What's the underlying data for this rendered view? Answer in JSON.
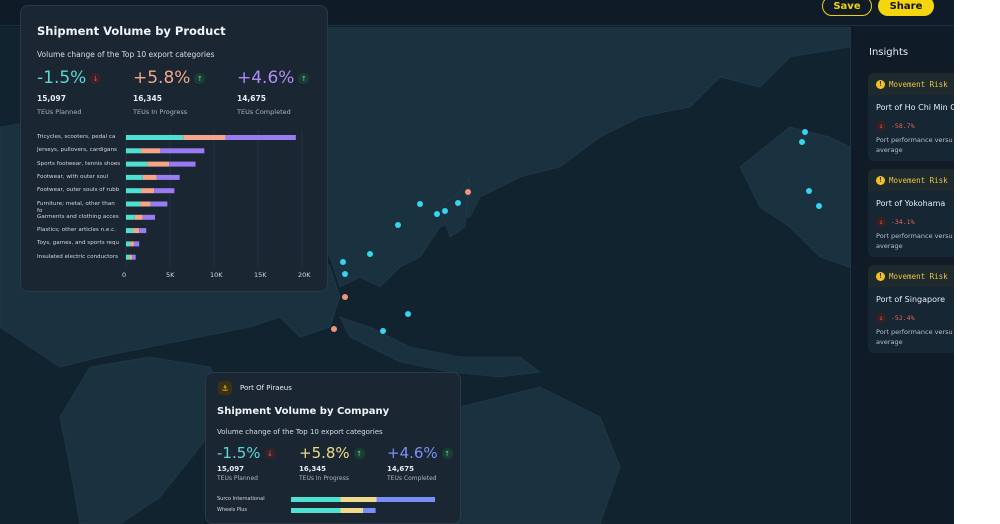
{
  "toolbar": {
    "save_label": "Save",
    "share_label": "Share"
  },
  "insights": {
    "title": "Insights",
    "cards": [
      {
        "tag": "Movement Risk",
        "port": "Port of Ho Chi Min C",
        "change": "-58.7%",
        "desc_line1": "Port performance versu",
        "desc_line2": "average"
      },
      {
        "tag": "Movement Risk",
        "port": "Port of Yokohama",
        "change": "-34.1%",
        "desc_line1": "Port performance versu",
        "desc_line2": "average"
      },
      {
        "tag": "Movement Risk",
        "port": "Port of Singapore",
        "change": "-52.4%",
        "desc_line1": "Port performance versu",
        "desc_line2": "average"
      }
    ]
  },
  "product_card": {
    "title": "Shipment Volume by Product",
    "subtitle": "Volume change of the Top 10 export categories",
    "kpis": [
      {
        "change": "-1.5%",
        "direction": "down",
        "value": "15,097",
        "label": "TEUs Planned",
        "color": "#5ed6d6"
      },
      {
        "change": "+5.8%",
        "direction": "up",
        "value": "16,345",
        "label": "TEUs In Progress",
        "color": "#f3a68a"
      },
      {
        "change": "+4.6%",
        "direction": "up",
        "value": "14,675",
        "label": "TEUs Completed",
        "color": "#b18cf5"
      }
    ]
  },
  "company_card": {
    "port_badge": "Port Of Piraeus",
    "title": "Shipment Volume by Company",
    "subtitle": "Volume change of the Top 10 export categories",
    "kpis": [
      {
        "change": "-1.5%",
        "direction": "down",
        "value": "15,097",
        "label": "TEUs Planned",
        "color": "#5ed6d6"
      },
      {
        "change": "+5.8%",
        "direction": "up",
        "value": "16,345",
        "label": "TEUs In Progress",
        "color": "#f0d98a"
      },
      {
        "change": "+4.6%",
        "direction": "up",
        "value": "14,675",
        "label": "TEUs Completed",
        "color": "#7a8ff5"
      }
    ]
  },
  "chart_data": [
    {
      "type": "bar",
      "orientation": "horizontal",
      "stacked": true,
      "categories": [
        "Tricycles, scooters, pedal ca",
        "Jerseys, pullovers, cardigans",
        "Sports footwear, tennis shoes",
        "Footwear, with outer soul",
        "Footwear, outer souls of rubb",
        "Furniture; metal, other than fo",
        "Garments and clothing acces",
        "Plastics; other articles n.e.c.",
        "Toys, games, and sports requ",
        "Insulated electric conductors"
      ],
      "series": [
        {
          "color": "#4ee0d0",
          "values": [
            6500,
            1700,
            2400,
            1900,
            1700,
            1600,
            1000,
            800,
            500,
            400
          ]
        },
        {
          "color": "#f3a68a",
          "values": [
            4800,
            2200,
            2500,
            1600,
            1500,
            1200,
            900,
            700,
            400,
            300
          ]
        },
        {
          "color": "#9a7cf2",
          "values": [
            8000,
            5000,
            3000,
            2600,
            2300,
            1900,
            1400,
            800,
            600,
            400
          ]
        }
      ],
      "xticks": [
        "0",
        "5K",
        "10K",
        "15K",
        "20K"
      ],
      "xlim": [
        0,
        20000
      ],
      "grid": true
    },
    {
      "type": "bar",
      "orientation": "horizontal",
      "stacked": true,
      "categories": [
        "Surco International",
        "Wheels Plus"
      ],
      "series": [
        {
          "color": "#4ee0d0",
          "values": [
            5500,
            5500
          ]
        },
        {
          "color": "#f0d98a",
          "values": [
            4000,
            2500
          ]
        },
        {
          "color": "#7a8ff5",
          "values": [
            6500,
            1400
          ]
        }
      ],
      "xlim": [
        0,
        20000
      ]
    }
  ],
  "map_ports": [
    {
      "color": "#36d4ee"
    },
    {
      "color": "#36d4ee"
    },
    {
      "color": "#36d4ee"
    },
    {
      "color": "#36d4ee"
    },
    {
      "color": "#36d4ee"
    },
    {
      "color": "#36d4ee"
    },
    {
      "color": "#36d4ee"
    },
    {
      "color": "#36d4ee"
    },
    {
      "color": "#36d4ee"
    },
    {
      "color": "#36d4ee"
    },
    {
      "color": "#36d4ee"
    },
    {
      "color": "#36d4ee"
    },
    {
      "color": "#36d4ee"
    },
    {
      "color": "#36d4ee"
    },
    {
      "color": "#f0957a"
    },
    {
      "color": "#f0957a"
    },
    {
      "color": "#f0957a"
    }
  ]
}
